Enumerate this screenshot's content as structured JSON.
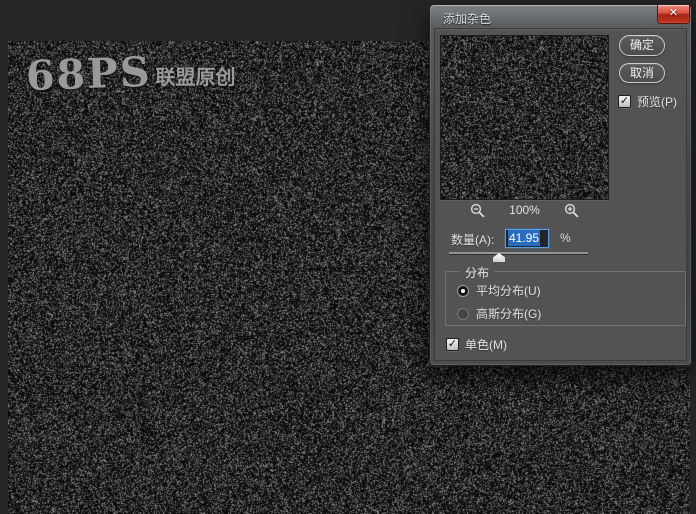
{
  "canvas": {
    "watermark_logo": "68PS",
    "watermark_text": "联盟原创"
  },
  "dialog": {
    "title": "添加杂色",
    "close_glyph": "✕",
    "ok_label": "确定",
    "cancel_label": "取消",
    "preview_label": "预览(P)",
    "check_glyph": "✓",
    "zoom_level": "100%",
    "amount_label": "数量(A):",
    "amount_value": "41.95",
    "amount_unit": "%",
    "slider_percent": 36,
    "distribution_legend": "分布",
    "distribution_options": [
      {
        "label": "平均分布(U)",
        "selected": true
      },
      {
        "label": "高斯分布(G)",
        "selected": false
      }
    ],
    "monochrome_label": "单色(M)"
  },
  "colors": {
    "selection_blue": "#2a6bbd",
    "focus_border": "#55a0e4",
    "close_red": "#c5392b",
    "dialog_bg": "#535353"
  }
}
